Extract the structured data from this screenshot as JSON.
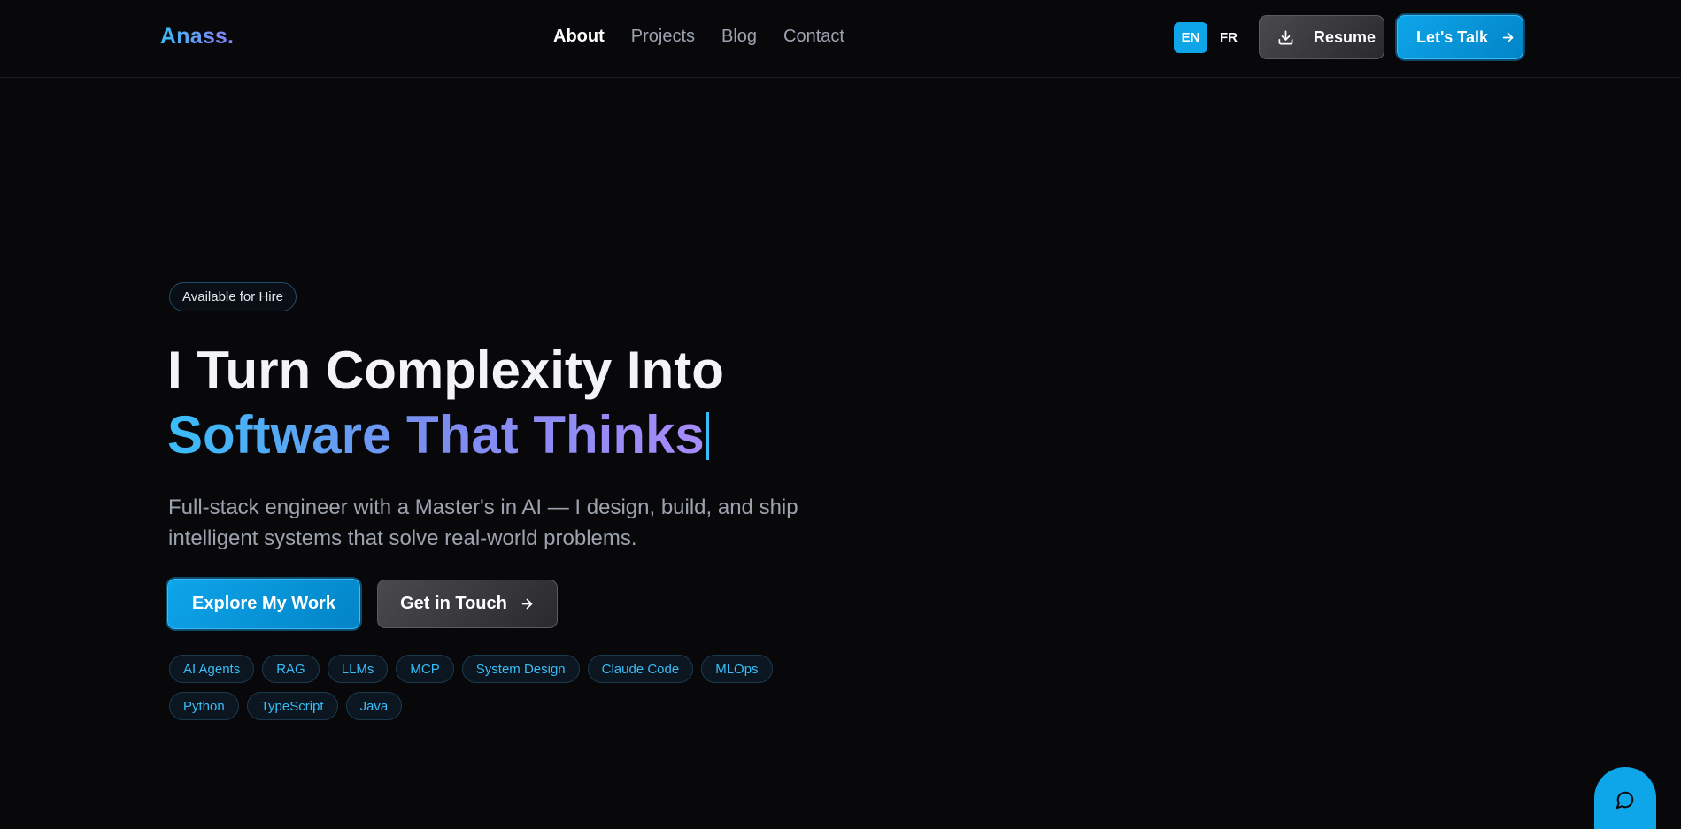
{
  "header": {
    "logo": "Anass.",
    "nav": [
      {
        "label": "About",
        "active": true
      },
      {
        "label": "Projects",
        "active": false
      },
      {
        "label": "Blog",
        "active": false
      },
      {
        "label": "Contact",
        "active": false
      }
    ],
    "languages": {
      "en": "EN",
      "fr": "FR",
      "selected": "EN"
    },
    "resume_label": "Resume",
    "talk_label": "Let's Talk"
  },
  "hero": {
    "badge": "Available for Hire",
    "headline_line1": "I Turn Complexity Into",
    "headline_line2": "Software That Thinks",
    "subtitle": "Full-stack engineer with a Master's in AI — I design, build, and ship intelligent systems that solve real-world problems.",
    "primary_cta": "Explore My Work",
    "secondary_cta": "Get in Touch",
    "tags": [
      "AI Agents",
      "RAG",
      "LLMs",
      "MCP",
      "System Design",
      "Claude Code",
      "MLOps",
      "Python",
      "TypeScript",
      "Java"
    ]
  },
  "icons": {
    "download": "download-icon",
    "arrow": "arrow-right-icon",
    "chat": "chat-bubble-icon"
  },
  "colors": {
    "background": "#08080b",
    "accent": "#0ea5e9",
    "accent_light": "#38bdf8",
    "gradient_end": "#a78bfa",
    "muted_text": "#9ca3af"
  }
}
